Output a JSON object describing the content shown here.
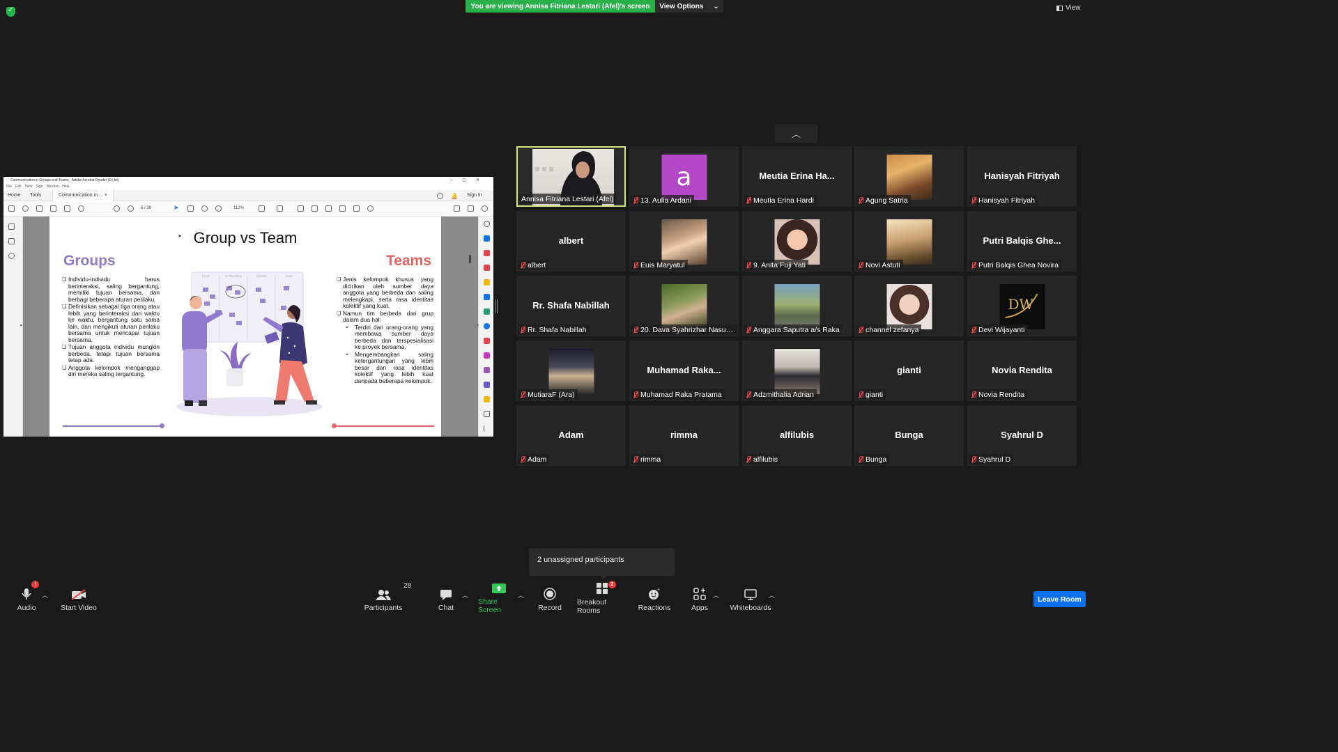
{
  "top": {
    "viewing_banner": "You are viewing Annisa Fitriana Lestari (Afel)'s screen",
    "view_options": "View Options",
    "view_button": "View"
  },
  "acrobat": {
    "window_title": "Communication in Groups and Teams - Adobe Acrobat Reader (64-bit)",
    "menu": [
      "File",
      "Edit",
      "View",
      "Sign",
      "Window",
      "Help"
    ],
    "tab_home": "Home",
    "tab_tools": "Tools",
    "tab_doc": "Communication in ...",
    "sign_in": "Sign In",
    "page_current": "6",
    "page_total": "/ 30",
    "zoom": "112%"
  },
  "slide": {
    "title": "Group vs Team",
    "groups_heading": "Groups",
    "teams_heading": "Teams",
    "groups_points": [
      "Individu-individu harus berinteraksi, saling bergantung, memiliki tujuan bersama, dan berbagi beberapa aturan perilaku.",
      "Definisikan sebagai tiga orang atau lebih yang berinteraksi dari waktu ke waktu, bergantung satu sama lain, dan mengikuti aturan perilaku bersama untuk mencapai tujuan bersama.",
      "Tujuan anggota individu mungkin berbeda, tetapi tujuan bersama tetap ada.",
      "Anggota kelompok menganggap diri mereka saling tergantung."
    ],
    "teams_points": [
      "Jenis kelompok khusus yang dicirikan oleh sumber daya anggota yang berbeda dan saling melengkapi, serta rasa identitas kolektif yang kuat.",
      "Namun tim berbeda dari grup dalam dua hal:"
    ],
    "teams_subpoints": [
      "Terdiri dari orang-orang yang membawa sumber daya berbeda dan terspesialisasi ke proyek bersama.",
      "Mengembangkan saling ketergantungan yang lebih besar dan rasa identitas kolektif yang lebih kuat daripada beberapa kelompok."
    ],
    "board_columns": [
      "TO DO",
      "IN PROGRESS",
      "TESTING",
      "DONE"
    ]
  },
  "participants": [
    {
      "label": "Annisa Fitriana Lestari (Afel)",
      "display": "",
      "kind": "video-woman-hijab",
      "active": true,
      "muted": false
    },
    {
      "label": "13. Aulia Ardani",
      "display": "a",
      "kind": "letter",
      "muted": true
    },
    {
      "label": "Meutia Erina Hardi",
      "display": "Meutia Erina Ha...",
      "kind": "name",
      "muted": true
    },
    {
      "label": "Agung Satria",
      "display": "",
      "kind": "photo-warm",
      "muted": true
    },
    {
      "label": "Hanisyah Fitriyah",
      "display": "Hanisyah Fitriyah",
      "kind": "name",
      "muted": true
    },
    {
      "label": "albert",
      "display": "albert",
      "kind": "name",
      "muted": true
    },
    {
      "label": "Euis Maryatul",
      "display": "",
      "kind": "photo-portrait",
      "muted": true
    },
    {
      "label": "9. Anita Fuji Yati",
      "display": "",
      "kind": "photo-selfie",
      "muted": true
    },
    {
      "label": "Novi Astuti",
      "display": "",
      "kind": "photo-sunset",
      "muted": true
    },
    {
      "label": "Putri Balqis Ghea Novira",
      "display": "Putri Balqis Ghe...",
      "kind": "name",
      "muted": true
    },
    {
      "label": "Rr. Shafa Nabillah",
      "display": "Rr. Shafa Nabillah",
      "kind": "name",
      "muted": true
    },
    {
      "label": "20. Dava Syahrizhar Nasution",
      "display": "",
      "kind": "photo-green",
      "muted": true
    },
    {
      "label": "Anggara Saputra a/s Raka",
      "display": "",
      "kind": "photo-outdoor",
      "muted": true
    },
    {
      "label": "channel zefanya",
      "display": "",
      "kind": "photo-selfie2",
      "muted": true
    },
    {
      "label": "Devi Wijayanti",
      "display": "",
      "kind": "logo-dw",
      "muted": true
    },
    {
      "label": "MutiaraF (Ara)",
      "display": "",
      "kind": "photo-night",
      "muted": true
    },
    {
      "label": "Muhamad Raka Pratama",
      "display": "Muhamad  Raka...",
      "kind": "name",
      "muted": true
    },
    {
      "label": "Adzmithalia Adrian",
      "display": "",
      "kind": "photo-hijab",
      "muted": true
    },
    {
      "label": "gianti",
      "display": "gianti",
      "kind": "name",
      "muted": true
    },
    {
      "label": "Novia Rendita",
      "display": "Novia Rendita",
      "kind": "name",
      "muted": true
    },
    {
      "label": "Adam",
      "display": "Adam",
      "kind": "name",
      "muted": true
    },
    {
      "label": "rimma",
      "display": "rimma",
      "kind": "name",
      "muted": true
    },
    {
      "label": "alfilubis",
      "display": "alfilubis",
      "kind": "name",
      "muted": true
    },
    {
      "label": "Bunga",
      "display": "Bunga",
      "kind": "name",
      "muted": true
    },
    {
      "label": "Syahrul D",
      "display": "Syahrul D",
      "kind": "name",
      "muted": true
    }
  ],
  "tooltip": "2 unassigned participants",
  "toolbar": {
    "audio": "Audio",
    "audio_badge": "!",
    "start_video": "Start Video",
    "participants": "Participants",
    "participants_count": "28",
    "chat": "Chat",
    "share_screen": "Share Screen",
    "record": "Record",
    "breakout_rooms": "Breakout Rooms",
    "breakout_badge": "2",
    "reactions": "Reactions",
    "apps": "Apps",
    "whiteboards": "Whiteboards",
    "leave_room": "Leave Room"
  },
  "colors": {
    "accent_green": "#2ab04a",
    "active_speaker": "#d2e87a",
    "leave_blue": "#0e71eb",
    "groups_purple": "#8e7bc4",
    "teams_red": "#e06565"
  }
}
